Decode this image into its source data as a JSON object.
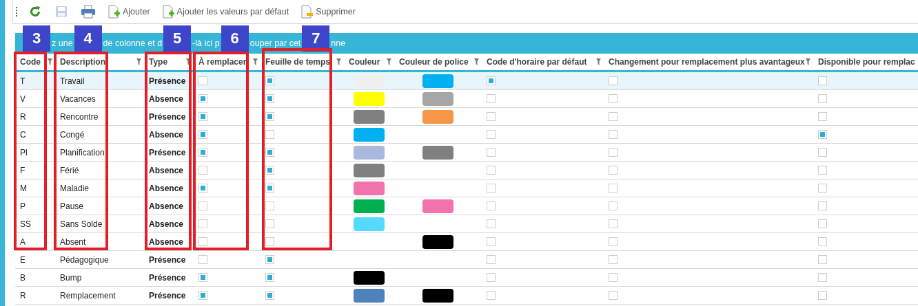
{
  "toolbar": {
    "buttons": [
      {
        "kind": "refresh",
        "disabled": false
      },
      {
        "kind": "save",
        "disabled": true
      },
      {
        "kind": "print",
        "disabled": false
      },
      {
        "kind": "add",
        "label": "Ajouter",
        "disabled": false
      },
      {
        "kind": "add",
        "label": "Ajouter les valeurs par défaut",
        "disabled": false
      },
      {
        "kind": "delete",
        "label": "Supprimer",
        "disabled": false
      }
    ]
  },
  "group_panel": {
    "fragments": [
      "z une",
      "de colonne et d",
      "-là ici p",
      "ouper par cet",
      "nne"
    ]
  },
  "annotations": [
    {
      "label": "3"
    },
    {
      "label": "4"
    },
    {
      "label": "5"
    },
    {
      "label": "6"
    },
    {
      "label": "7"
    }
  ],
  "table": {
    "columns": [
      {
        "label": "Code",
        "kind": "text"
      },
      {
        "label": "Description",
        "kind": "text"
      },
      {
        "label": "Type",
        "kind": "bold"
      },
      {
        "label": "À remplacer",
        "kind": "check"
      },
      {
        "label": "Feuille de temps",
        "kind": "check"
      },
      {
        "label": "Couleur",
        "kind": "swatch"
      },
      {
        "label": "Couleur de police",
        "kind": "swatch"
      },
      {
        "label": "Code d'horaire par défaut",
        "kind": "check"
      },
      {
        "label": "Changement pour remplacement plus avantageux",
        "kind": "check"
      },
      {
        "label": "Disponible pour remplac",
        "kind": "check"
      }
    ],
    "rows": [
      {
        "selected": true,
        "code": "T",
        "description": "Travail",
        "type": "Présence",
        "to_replace": false,
        "timesheet": true,
        "color": "#f0f0f0",
        "font": {
          "color": "#00b0f0"
        },
        "default_schedule_code": true,
        "better_replacement_change": false,
        "available_for_replacement": false
      },
      {
        "selected": false,
        "code": "V",
        "description": "Vacances",
        "type": "Absence",
        "to_replace": true,
        "timesheet": true,
        "color": "#ffff00",
        "font": {
          "color": "#a6a6a6"
        },
        "default_schedule_code": false,
        "better_replacement_change": false,
        "available_for_replacement": false
      },
      {
        "selected": false,
        "code": "R",
        "description": "Rencontre",
        "type": "Présence",
        "to_replace": true,
        "timesheet": true,
        "color": "#808080",
        "font": {
          "color": "#f79646"
        },
        "default_schedule_code": false,
        "better_replacement_change": false,
        "available_for_replacement": false
      },
      {
        "selected": false,
        "code": "C",
        "description": "Congé",
        "type": "Absence",
        "to_replace": true,
        "timesheet": false,
        "color": "#00b0f0",
        "default_schedule_code": false,
        "better_replacement_change": false,
        "available_for_replacement": true
      },
      {
        "selected": false,
        "code": "Pl",
        "description": "Planification",
        "type": "Présence",
        "to_replace": true,
        "timesheet": true,
        "color": "#a9b8dc",
        "font": {
          "color": "#808080"
        },
        "default_schedule_code": false,
        "better_replacement_change": false,
        "available_for_replacement": false
      },
      {
        "selected": false,
        "code": "F",
        "description": "Férié",
        "type": "Absence",
        "to_replace": false,
        "timesheet": true,
        "color": "#808080",
        "default_schedule_code": false,
        "better_replacement_change": false,
        "available_for_replacement": false
      },
      {
        "selected": false,
        "code": "M",
        "description": "Maladie",
        "type": "Absence",
        "to_replace": true,
        "timesheet": true,
        "color": "#f272ac",
        "default_schedule_code": false,
        "better_replacement_change": false,
        "available_for_replacement": false
      },
      {
        "selected": false,
        "code": "P",
        "description": "Pause",
        "type": "Absence",
        "to_replace": false,
        "timesheet": false,
        "color": "#00b050",
        "font": {
          "color": "#f272ac"
        },
        "default_schedule_code": false,
        "better_replacement_change": false,
        "available_for_replacement": false
      },
      {
        "selected": false,
        "code": "SS",
        "description": "Sans Solde",
        "type": "Absence",
        "to_replace": false,
        "timesheet": false,
        "color": "#55d9fc",
        "default_schedule_code": false,
        "better_replacement_change": false,
        "available_for_replacement": false
      },
      {
        "selected": false,
        "code": "A",
        "description": "Absent",
        "type": "Absence",
        "to_replace": false,
        "timesheet": false,
        "font": {
          "color": "#000000"
        },
        "default_schedule_code": false,
        "better_replacement_change": false,
        "available_for_replacement": false
      },
      {
        "selected": false,
        "code": "E",
        "description": "Pédagogique",
        "type": "Présence",
        "to_replace": false,
        "timesheet": true,
        "default_schedule_code": false,
        "better_replacement_change": false,
        "available_for_replacement": false
      },
      {
        "selected": false,
        "code": "B",
        "description": "Bump",
        "type": "Présence",
        "to_replace": true,
        "timesheet": true,
        "color": "#000000",
        "default_schedule_code": false,
        "better_replacement_change": false,
        "available_for_replacement": false
      },
      {
        "selected": false,
        "code": "R",
        "description": "Remplacement",
        "type": "Présence",
        "to_replace": true,
        "timesheet": true,
        "color": "#4f81bd",
        "font": {
          "color": "#000000"
        },
        "default_schedule_code": false,
        "better_replacement_change": false,
        "available_for_replacement": false
      }
    ]
  }
}
